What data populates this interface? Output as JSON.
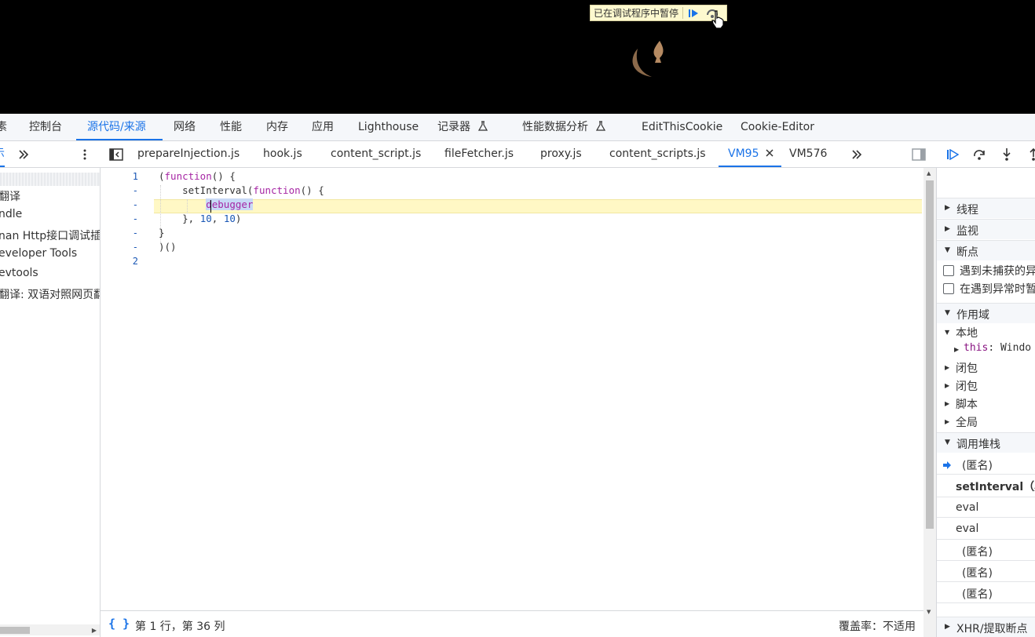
{
  "page": {
    "paused_banner_text": "已在调试程序中暂停",
    "resume_button_icon": "resume-icon",
    "step_over_button_icon": "step-over-icon",
    "cursor_icon": "hand-pointer-icon",
    "logo_icon": "spade-moon-logo"
  },
  "main_tabs": [
    {
      "label": "素",
      "active": false
    },
    {
      "label": "控制台",
      "active": false
    },
    {
      "label": "源代码/来源",
      "active": true
    },
    {
      "label": "网络",
      "active": false
    },
    {
      "label": "性能",
      "active": false
    },
    {
      "label": "内存",
      "active": false
    },
    {
      "label": "应用",
      "active": false
    },
    {
      "label": "Lighthouse",
      "active": false
    },
    {
      "label": "记录器",
      "active": false,
      "experimental": true
    },
    {
      "label": "性能数据分析",
      "active": false,
      "experimental": true
    },
    {
      "label": "EditThisCookie",
      "active": false
    },
    {
      "label": "Cookie-Editor",
      "active": false
    }
  ],
  "navigator": {
    "tab_label": "示",
    "more_icon": "double-chevron-right-icon",
    "items": [
      "翻译",
      "ndle",
      "nan Http接口调试插",
      "eveloper Tools",
      "evtools",
      "翻译: 双语对照网页翻"
    ]
  },
  "file_tabs": {
    "menu_icon": "kebab-menu-icon",
    "toggle_navigator_icon": "toggle-navigator-icon",
    "files": [
      "prepareInjection.js",
      "hook.js",
      "content_script.js",
      "fileFetcher.js",
      "proxy.js",
      "content_scripts.js",
      "VM95",
      "VM576"
    ],
    "active_file": "VM95",
    "close_icon": "close-icon",
    "overflow_icon": "double-chevron-right-icon",
    "toggle_sidebar_icon": "toggle-debugger-sidebar-icon"
  },
  "debug_controls": [
    "resume-icon",
    "step-over-icon",
    "step-into-icon",
    "step-out-icon"
  ],
  "editor": {
    "gutter": [
      "1",
      "-",
      "-",
      "-",
      "-",
      "-",
      "2"
    ],
    "lines": [
      "(function() {",
      "    setInterval(function() {",
      "        debugger",
      "    }, 10, 10)",
      "}",
      ")()",
      ""
    ],
    "paused_line_index": 2
  },
  "status_bar": {
    "pretty_print_icon": "curly-braces-icon",
    "position": "第 1 行，第 36 列",
    "coverage": "覆盖率：不适用"
  },
  "sidebar": {
    "sections": {
      "threads": "线程",
      "watch": "监视",
      "breakpoints": "断点",
      "scope": "作用域",
      "call_stack": "调用堆栈",
      "xhr_breakpoints": "XHR/提取断点"
    },
    "breakpoint_options": [
      "遇到未捕获的异",
      "在遇到异常时暂"
    ],
    "scope": {
      "local_label": "本地",
      "this_key": "this",
      "this_value": "Windo",
      "closures": [
        "闭包",
        "闭包",
        "脚本",
        "全局"
      ]
    },
    "call_stack": [
      {
        "label": "(匿名)",
        "current": true,
        "bold": false
      },
      {
        "label": "setInterval（异",
        "current": false,
        "bold": true
      },
      {
        "label": "eval",
        "current": false,
        "bold": false
      },
      {
        "label": "eval",
        "current": false,
        "bold": false
      },
      {
        "label": "(匿名)",
        "current": false,
        "bold": false
      },
      {
        "label": "(匿名)",
        "current": false,
        "bold": false
      },
      {
        "label": "(匿名)",
        "current": false,
        "bold": false
      }
    ]
  },
  "colors": {
    "accent": "#1a73e8",
    "paused_line": "#fff8c5",
    "banner": "#fdf9cf",
    "keyword": "#a626a4",
    "number": "#1a57b5"
  }
}
